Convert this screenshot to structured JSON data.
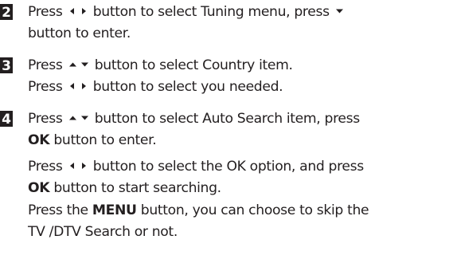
{
  "steps": [
    {
      "number": "2",
      "lines": [
        [
          {
            "t": "Press "
          },
          {
            "icon": "arrow-left-icon"
          },
          {
            "icon": "arrow-right-icon"
          },
          {
            "t": " button to select Tuning menu, press "
          },
          {
            "icon": "arrow-down-icon"
          }
        ],
        [
          {
            "t": "button to enter."
          }
        ]
      ]
    },
    {
      "number": "3",
      "lines": [
        [
          {
            "t": "Press "
          },
          {
            "icon": "arrow-up-icon"
          },
          {
            "icon": "arrow-down-icon"
          },
          {
            "t": " button to select Country item."
          }
        ],
        [
          {
            "t": "Press "
          },
          {
            "icon": "arrow-left-icon"
          },
          {
            "icon": "arrow-right-icon"
          },
          {
            "t": " button to select you needed."
          }
        ]
      ]
    },
    {
      "number": "4",
      "lines": [
        [
          {
            "t": "Press "
          },
          {
            "icon": "arrow-up-icon"
          },
          {
            "icon": "arrow-down-icon"
          },
          {
            "t": " button to select Auto Search item, press"
          }
        ],
        [
          {
            "t": "OK",
            "b": true
          },
          {
            "t": " button to enter."
          }
        ],
        [
          {
            "t": "Press "
          },
          {
            "icon": "arrow-left-icon"
          },
          {
            "icon": "arrow-right-icon"
          },
          {
            "t": " button to select the OK option, and press"
          }
        ],
        [
          {
            "t": "OK",
            "b": true
          },
          {
            "t": " button to start searching."
          }
        ],
        [
          {
            "t": "Press the "
          },
          {
            "t": "MENU",
            "b": true
          },
          {
            "t": " button, you can choose to skip the"
          }
        ],
        [
          {
            "t": "TV /DTV Search or not."
          }
        ]
      ]
    }
  ]
}
